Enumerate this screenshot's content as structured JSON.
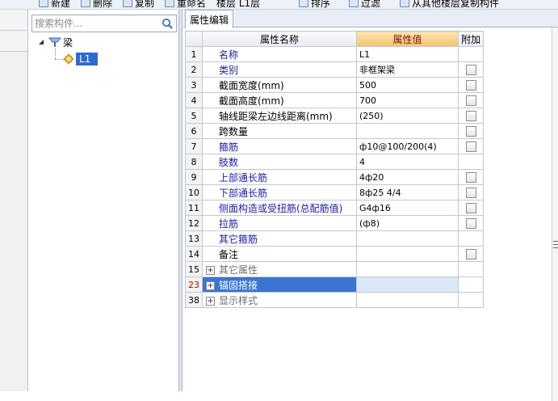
{
  "toolbar": {
    "items": [
      {
        "label": "新建",
        "icon": "new-icon"
      },
      {
        "label": "删除",
        "icon": "delete-icon"
      },
      {
        "label": "复制",
        "icon": "copy-icon"
      },
      {
        "label": "重命名",
        "icon": "rename-icon"
      },
      {
        "label": "楼层 L1层",
        "icon": "floor-select"
      },
      {
        "label": "排序",
        "icon": "sort-icon"
      },
      {
        "label": "过滤",
        "icon": "filter-icon"
      },
      {
        "label": "从其他楼层复制构件",
        "icon": "copy-from-floor-icon"
      }
    ]
  },
  "tree": {
    "search_placeholder": "搜索构件...",
    "root_label": "梁",
    "child_label": "L1",
    "root_toggle": "◢"
  },
  "tab": {
    "label": "属性编辑"
  },
  "grid": {
    "headers": {
      "name": "属性名称",
      "value": "属性值",
      "attach": "附加"
    },
    "rows": [
      {
        "num": "1",
        "name": "名称",
        "value": "L1",
        "color": "blue",
        "checkbox": false
      },
      {
        "num": "2",
        "name": "类别",
        "value": "非框架梁",
        "color": "blue",
        "checkbox": true
      },
      {
        "num": "3",
        "name": "截面宽度(mm)",
        "value": "500",
        "color": "black",
        "checkbox": true
      },
      {
        "num": "4",
        "name": "截面高度(mm)",
        "value": "700",
        "color": "black",
        "checkbox": true
      },
      {
        "num": "5",
        "name": "轴线距梁左边线距离(mm)",
        "value": "(250)",
        "color": "black",
        "checkbox": true
      },
      {
        "num": "6",
        "name": "跨数量",
        "value": "",
        "color": "black",
        "checkbox": true
      },
      {
        "num": "7",
        "name": "箍筋",
        "value": "ф10@100/200(4)",
        "color": "blue",
        "checkbox": true
      },
      {
        "num": "8",
        "name": "肢数",
        "value": "4",
        "color": "blue",
        "checkbox": false
      },
      {
        "num": "9",
        "name": "上部通长筋",
        "value": "4ф20",
        "color": "blue",
        "checkbox": true
      },
      {
        "num": "10",
        "name": "下部通长筋",
        "value": "8ф25 4/4",
        "color": "blue",
        "checkbox": true
      },
      {
        "num": "11",
        "name": "侧面构造或受扭筋(总配筋值)",
        "value": "G4ф16",
        "color": "blue",
        "checkbox": true
      },
      {
        "num": "12",
        "name": "拉筋",
        "value": "(ф8)",
        "color": "blue",
        "checkbox": true
      },
      {
        "num": "13",
        "name": "其它箍筋",
        "value": "",
        "color": "blue",
        "checkbox": false
      },
      {
        "num": "14",
        "name": "备注",
        "value": "",
        "color": "black",
        "checkbox": true
      }
    ],
    "groups": [
      {
        "num": "15",
        "name": "其它属性",
        "expander": "+",
        "selected": false
      },
      {
        "num": "23",
        "name": "锚固搭接",
        "expander": "+",
        "selected": true
      },
      {
        "num": "38",
        "name": "显示样式",
        "expander": "+",
        "selected": false
      }
    ]
  },
  "colors": {
    "selection": "#3a75d0",
    "blue_text": "#1a1aa8",
    "header_value_bg": "#f5c26b"
  }
}
